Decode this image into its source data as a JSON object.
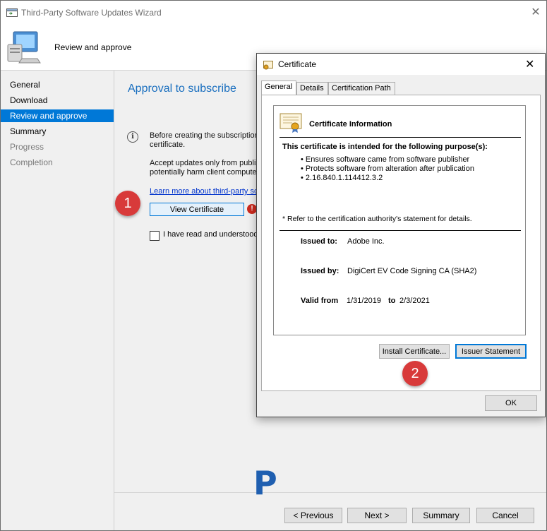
{
  "wizard": {
    "title": "Third-Party Software Updates Wizard",
    "close_glyph": "✕",
    "header_text": "Review and approve",
    "nav": [
      {
        "label": "General",
        "state": "normal"
      },
      {
        "label": "Download",
        "state": "normal"
      },
      {
        "label": "Review and approve",
        "state": "active"
      },
      {
        "label": "Summary",
        "state": "normal"
      },
      {
        "label": "Progress",
        "state": "disabled"
      },
      {
        "label": "Completion",
        "state": "disabled"
      }
    ],
    "content": {
      "title": "Approval to subscribe",
      "para1_line1": "Before creating the subscription t",
      "para1_line2": "certificate.",
      "para2_line1": "Accept updates only from publish",
      "para2_line2": "potentially harm client computers",
      "learn_link": "Learn more about third-party soft",
      "view_cert_button": "View Certificate",
      "checkbox_label": "I have read and understood"
    },
    "footer": {
      "previous": "< Previous",
      "next": "Next >",
      "summary": "Summary",
      "cancel": "Cancel"
    }
  },
  "annotations": {
    "badge1": "1",
    "badge2": "2"
  },
  "certificate_dialog": {
    "title": "Certificate",
    "close_glyph": "✕",
    "tabs": [
      "General",
      "Details",
      "Certification Path"
    ],
    "selected_tab": "General",
    "info_title": "Certificate Information",
    "purpose_heading": "This certificate is intended for the following purpose(s):",
    "purposes": [
      "• Ensures software came from software publisher",
      "• Protects software from alteration after publication",
      "• 2.16.840.1.114412.3.2"
    ],
    "note": "* Refer to the certification authority's statement for details.",
    "issued_to_label": "Issued to:",
    "issued_to_value": "Adobe Inc.",
    "issued_by_label": "Issued by:",
    "issued_by_value": "DigiCert EV Code Signing CA (SHA2)",
    "valid_from_label": "Valid from",
    "valid_from_value": "1/31/2019",
    "valid_to_label": "to",
    "valid_to_value": "2/3/2021",
    "install_button": "Install Certificate...",
    "issuer_button": "Issuer Statement",
    "ok_button": "OK"
  },
  "watermark_logo": "P"
}
